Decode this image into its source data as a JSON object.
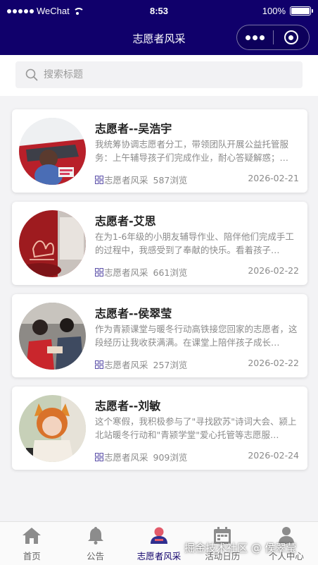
{
  "status_bar": {
    "carrier": "WeChat",
    "time": "8:53",
    "battery": "100%"
  },
  "nav": {
    "title": "志愿者风采",
    "accent_color": "#10006b"
  },
  "search": {
    "placeholder": "搜索标题",
    "value": ""
  },
  "articles": [
    {
      "title": "志愿者--吴浩宇",
      "summary": "我统筹协调志愿者分工，带领团队开展公益托管服务：上午辅导孩子们完成作业，耐心答疑解惑；…",
      "category": "志愿者风采",
      "views": "587浏览",
      "date": "2026-02-21"
    },
    {
      "title": "志愿者-艾思",
      "summary": "在为1-6年级的小朋友辅导作业、陪伴他们完成手工的过程中，我感受到了奉献的快乐。看着孩子…",
      "category": "志愿者风采",
      "views": "661浏览",
      "date": "2026-02-22"
    },
    {
      "title": "志愿者--侯翠莹",
      "summary": "作为青颍课堂与暖冬行动高铁接您回家的志愿者，这段经历让我收获满满。在课堂上陪伴孩子成长…",
      "category": "志愿者风采",
      "views": "257浏览",
      "date": "2026-02-22"
    },
    {
      "title": "志愿者--刘敏",
      "summary": "这个寒假，我积极参与了\"寻找欧苏\"诗词大会、颍上北站暖冬行动和\"青颍学堂\"爱心托管等志愿服…",
      "category": "志愿者风采",
      "views": "909浏览",
      "date": "2026-02-24"
    }
  ],
  "tabbar": {
    "items": [
      {
        "label": "首页",
        "icon": "home-icon"
      },
      {
        "label": "公告",
        "icon": "bell-icon"
      },
      {
        "label": "志愿者风采",
        "icon": "volunteer-icon"
      },
      {
        "label": "活动日历",
        "icon": "calendar-icon"
      },
      {
        "label": "个人中心",
        "icon": "person-icon"
      }
    ],
    "active_index": 2
  },
  "watermark": "掘金技术社区 @ 侯翠莹"
}
